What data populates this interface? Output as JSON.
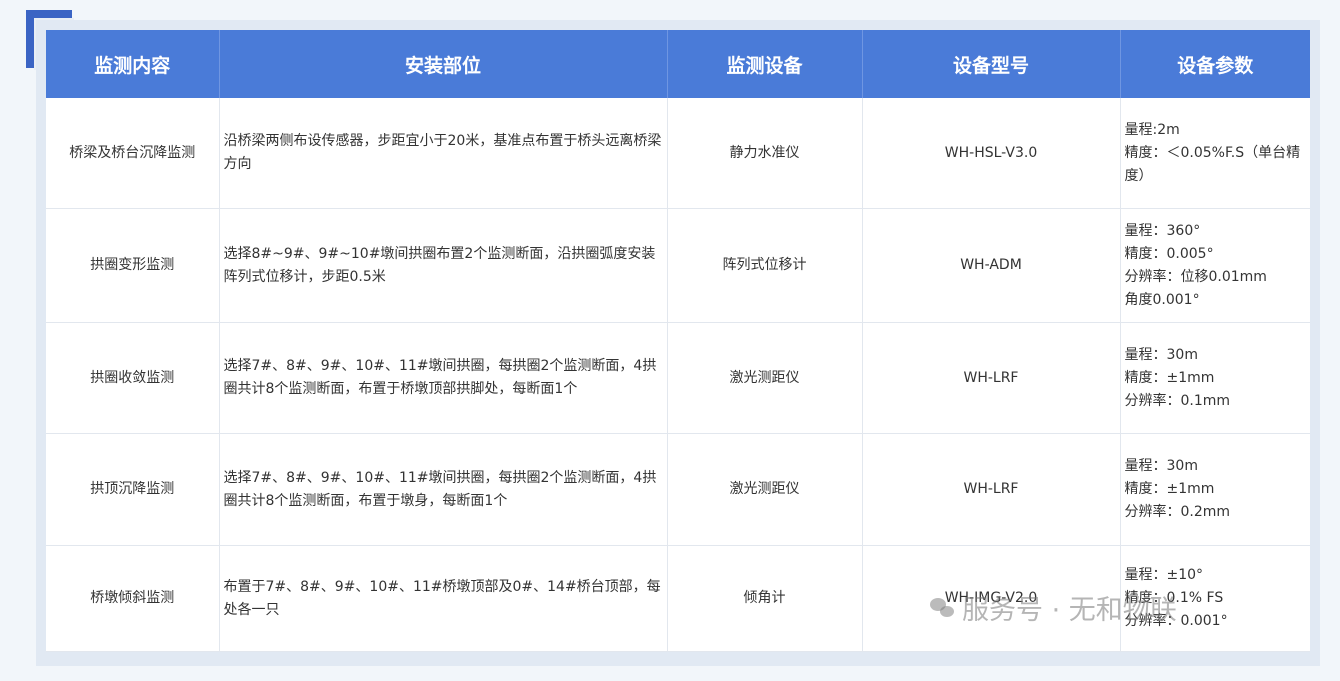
{
  "table": {
    "headers": [
      "监测内容",
      "安装部位",
      "监测设备",
      "设备型号",
      "设备参数"
    ],
    "rows": [
      {
        "content": "桥梁及桥台沉降监测",
        "location": "沿桥梁两侧布设传感器，步距宜小于20米，基准点布置于桥头远离桥梁方向",
        "device": "静力水准仪",
        "model": "WH-HSL-V3.0",
        "params": [
          "量程:2m",
          "精度：＜0.05%F.S（单台精度）"
        ]
      },
      {
        "content": "拱圈变形监测",
        "location": "选择8#~9#、9#~10#墩间拱圈布置2个监测断面，沿拱圈弧度安装阵列式位移计，步距0.5米",
        "device": "阵列式位移计",
        "model": "WH-ADM",
        "params": [
          "量程：360°",
          "精度：0.005°",
          "分辨率：位移0.01mm",
          "角度0.001°"
        ]
      },
      {
        "content": "拱圈收敛监测",
        "location": "选择7#、8#、9#、10#、11#墩间拱圈，每拱圈2个监测断面，4拱圈共计8个监测断面，布置于桥墩顶部拱脚处，每断面1个",
        "device": "激光测距仪",
        "model": "WH-LRF",
        "params": [
          "量程：30m",
          "精度：±1mm",
          "分辨率：0.1mm"
        ]
      },
      {
        "content": "拱顶沉降监测",
        "location": "选择7#、8#、9#、10#、11#墩间拱圈，每拱圈2个监测断面，4拱圈共计8个监测断面，布置于墩身，每断面1个",
        "device": "激光测距仪",
        "model": "WH-LRF",
        "params": [
          "量程：30m",
          "精度：±1mm",
          "分辨率：0.2mm"
        ]
      },
      {
        "content": "桥墩倾斜监测",
        "location": "布置于7#、8#、9#、10#、11#桥墩顶部及0#、14#桥台顶部，每处各一只",
        "device": "倾角计",
        "model": "WH-IMG-V2.0",
        "params": [
          "量程：±10°",
          "精度：0.1% FS",
          "分辨率：0.001°"
        ]
      }
    ]
  },
  "watermark": {
    "text": "服务号 · 无和物联",
    "icon": "wechat-icon"
  }
}
